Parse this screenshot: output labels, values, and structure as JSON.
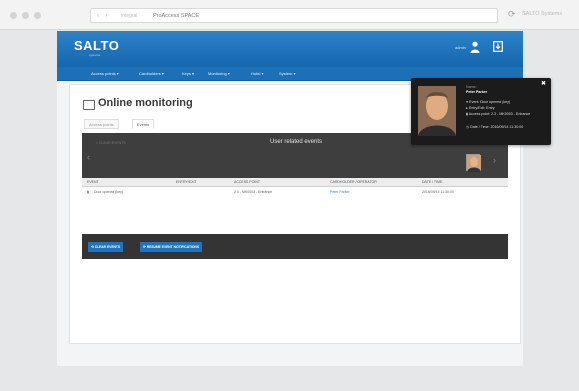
{
  "browser": {
    "address_prefix": "integral",
    "tab_title": "ProAccess SPACE",
    "brand": "SALTO Systems"
  },
  "app": {
    "logo": "SALTO",
    "logo_sub": "systems",
    "user": "admin"
  },
  "menu": [
    "Access points",
    "Cardholders",
    "Keys",
    "Monitoring",
    "Hotel",
    "System"
  ],
  "page": {
    "title": "Online monitoring",
    "tabs": [
      "Access points",
      "Events"
    ]
  },
  "panel": {
    "hint": "< CLEAR EVENTS",
    "title": "User related events"
  },
  "table": {
    "headers": [
      "EVENT",
      "ENTRY/EXIT",
      "ACCESS POINT",
      "CARDHOLDER / OPERATOR",
      "DATE / TIME"
    ],
    "rows": [
      {
        "event": "Door opened (key)",
        "entry": "",
        "access_point": "2.3 - MK0003 - Entrance",
        "holder": "Peter Parker",
        "date": "2016/09/14 11:30:00"
      }
    ]
  },
  "buttons": {
    "clear": "CLEAR EVENTS",
    "resume": "RESUME EVENT NOTIFICATIONS"
  },
  "popup": {
    "name_label": "Name:",
    "name": "Peter Parker",
    "event": "Event: Door opened (key)",
    "entry": "Entry/Exit: Entry",
    "access_point": "Access point: 2.3 - MK0003 - Entrance",
    "date": "Date / Time: 2016/09/14 11:30:00"
  },
  "colors": {
    "accent": "#1e70b6",
    "link": "#2c8ad8",
    "dark_panel": "#3e3e3e"
  }
}
